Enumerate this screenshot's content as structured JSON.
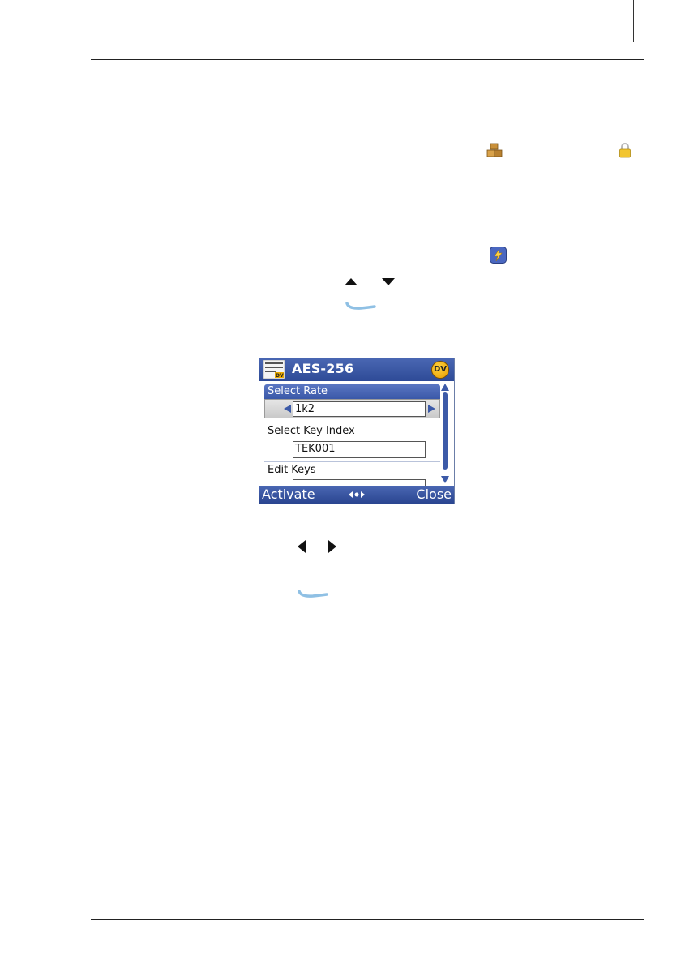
{
  "device": {
    "title": "AES-256",
    "badge": "DV",
    "fields": {
      "select_rate_label": "Select Rate",
      "select_rate_value": "1k2",
      "select_key_index_label": "Select Key Index",
      "select_key_index_value": "TEK001",
      "edit_keys_label": "Edit Keys"
    },
    "softkeys": {
      "left": "Activate",
      "right": "Close"
    }
  },
  "icons": {
    "doc": [
      "packages-icon",
      "lock-icon",
      "lightning-icon",
      "up-arrow-icon",
      "down-arrow-icon",
      "menu-key-icon",
      "left-arrow-icon",
      "right-arrow-icon",
      "menu-key-icon"
    ],
    "colors": {
      "device_header": "#3a56a2",
      "device_selection": "#4a67b3",
      "badge": "#f0b000",
      "menu_key": "#8fc0e4"
    }
  }
}
